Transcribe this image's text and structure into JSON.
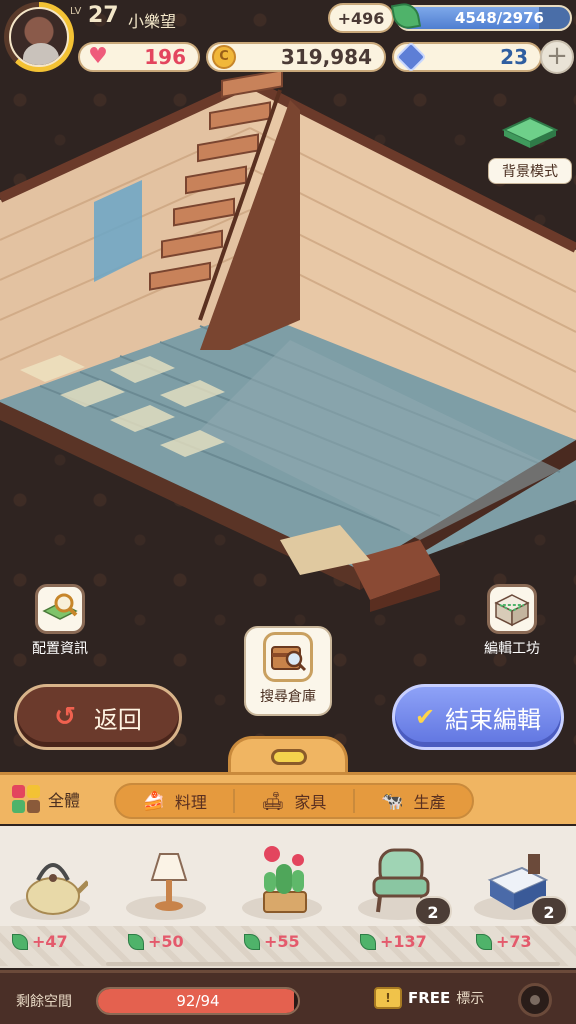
{
  "player": {
    "level_tag": "LV",
    "level": "27",
    "name": "小樂望"
  },
  "hud": {
    "bonus": "+496",
    "energy": "4548/2976",
    "energy_fraction": 0.82,
    "hearts": "196",
    "gold": "319,984",
    "gems": "23",
    "gem_plus_icon": "plus-icon",
    "coin_glyph": "C"
  },
  "room_controls": {
    "background_mode": "背景模式",
    "layout_info": "配置資訊",
    "edit_workshop": "編輯工坊",
    "search_warehouse": "搜尋倉庫"
  },
  "actions": {
    "back": "返回",
    "back_icon": "↺",
    "finish": "結束編輯",
    "finish_icon": "✔"
  },
  "filters": {
    "all": "全體",
    "categories": [
      {
        "label": "料理",
        "icon": "cake-icon"
      },
      {
        "label": "家具",
        "icon": "sofa-icon"
      },
      {
        "label": "生產",
        "icon": "cow-icon"
      }
    ]
  },
  "items": [
    {
      "name": "teapot",
      "gain": "+47",
      "count": ""
    },
    {
      "name": "table-lamp",
      "gain": "+50",
      "count": ""
    },
    {
      "name": "cactus-flower-pot",
      "gain": "+55",
      "count": ""
    },
    {
      "name": "green-armchair",
      "gain": "+137",
      "count": "2"
    },
    {
      "name": "supply-crate",
      "gain": "+73",
      "count": "2"
    }
  ],
  "footer": {
    "space_label": "剩餘空間",
    "space_value": "92/94",
    "space_fraction": 0.98,
    "free": "FREE",
    "mark": "標示"
  },
  "colors": {
    "accent_blue": "#6f84ea",
    "heart": "#e3455e",
    "panel": "#f0b562",
    "wall": "#e3c2a1",
    "floor": "#7e9ea6"
  }
}
